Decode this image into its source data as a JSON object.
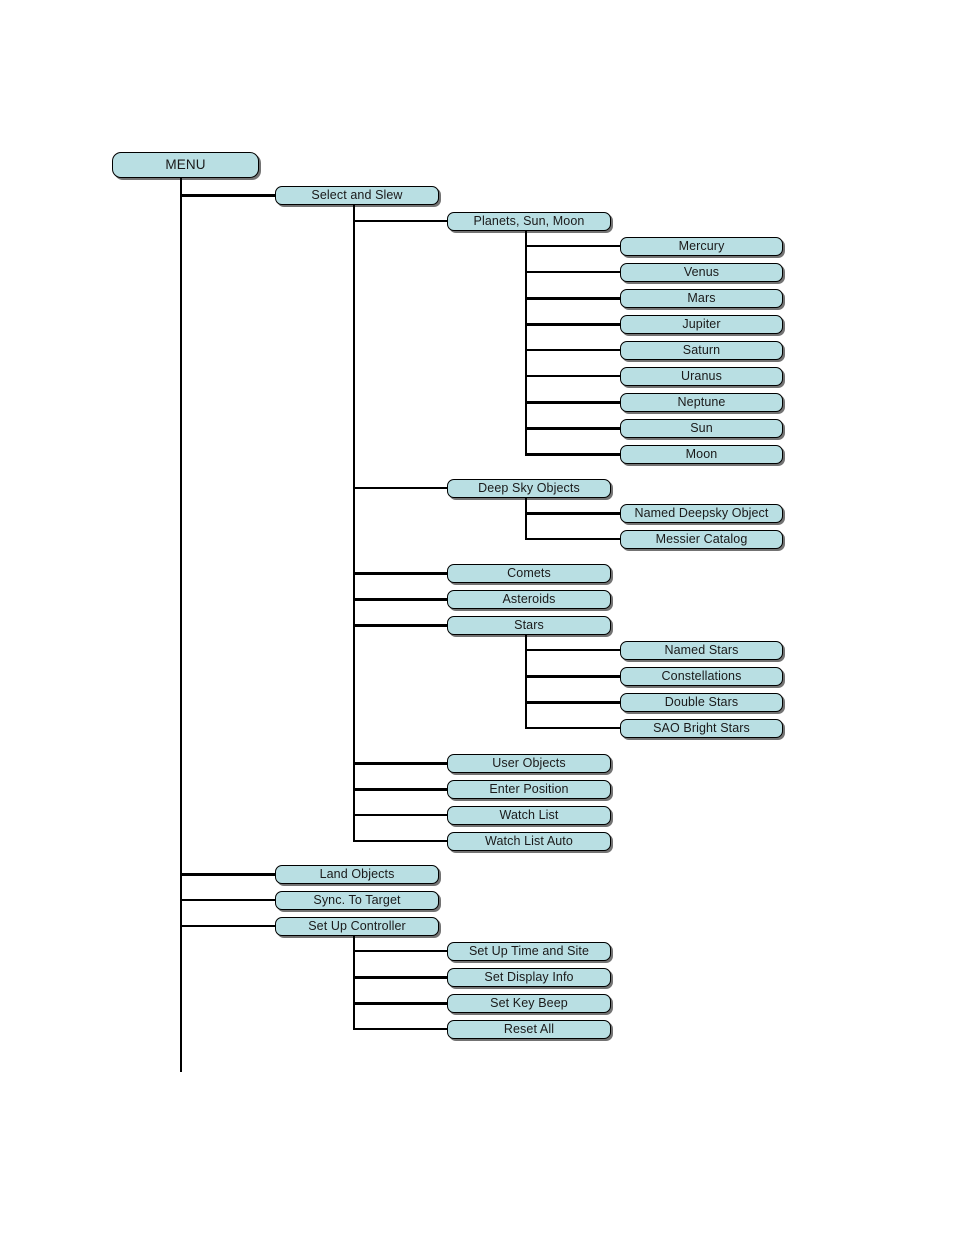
{
  "diagram": {
    "title": "MENU",
    "type": "menu-tree",
    "theme": {
      "node_fill": "#b9dfe3",
      "node_border": "#000000",
      "line_color": "#000000",
      "text_color": "#1a1a1a",
      "background": "#ffffff"
    },
    "root": {
      "label": "MENU"
    },
    "level1": [
      {
        "label": "Select and Slew"
      },
      {
        "label": "Land Objects"
      },
      {
        "label": "Sync. To Target"
      },
      {
        "label": "Set Up Controller"
      }
    ],
    "select_and_slew_children": [
      {
        "label": "Planets, Sun, Moon"
      },
      {
        "label": "Deep Sky Objects"
      },
      {
        "label": "Comets"
      },
      {
        "label": "Asteroids"
      },
      {
        "label": "Stars"
      },
      {
        "label": "User Objects"
      },
      {
        "label": "Enter Position"
      },
      {
        "label": "Watch List"
      },
      {
        "label": "Watch List Auto"
      }
    ],
    "planets_children": [
      {
        "label": "Mercury"
      },
      {
        "label": "Venus"
      },
      {
        "label": "Mars"
      },
      {
        "label": "Jupiter"
      },
      {
        "label": "Saturn"
      },
      {
        "label": "Uranus"
      },
      {
        "label": "Neptune"
      },
      {
        "label": "Sun"
      },
      {
        "label": "Moon"
      }
    ],
    "deep_sky_children": [
      {
        "label": "Named Deepsky Object"
      },
      {
        "label": "Messier Catalog"
      }
    ],
    "stars_children": [
      {
        "label": "Named Stars"
      },
      {
        "label": "Constellations"
      },
      {
        "label": "Double Stars"
      },
      {
        "label": "SAO Bright Stars"
      }
    ],
    "set_up_controller_children": [
      {
        "label": "Set Up Time and Site"
      },
      {
        "label": "Set Display Info"
      },
      {
        "label": "Set Key Beep"
      },
      {
        "label": "Reset All"
      }
    ]
  }
}
